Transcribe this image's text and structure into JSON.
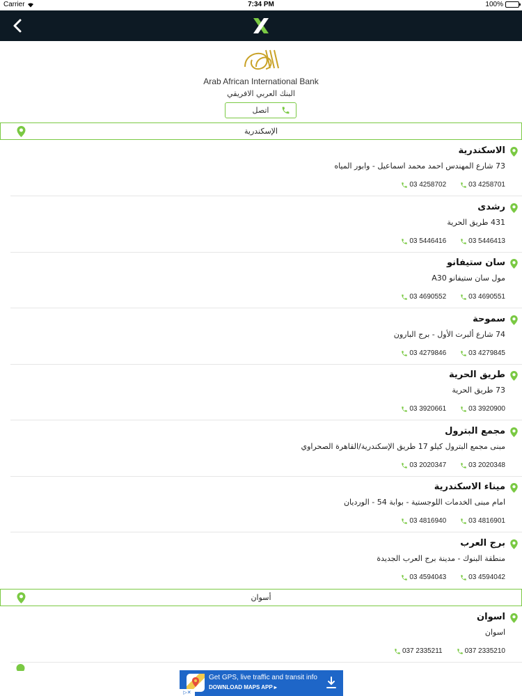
{
  "status_bar": {
    "carrier": "Carrier",
    "time": "7:34 PM",
    "battery": "100%"
  },
  "bank": {
    "name_en": "Arab African International Bank",
    "name_ar": "البنك العربي الافريقي",
    "call_label": "اتصل"
  },
  "colors": {
    "accent": "#7ac943",
    "nav_bg": "#0d1a24",
    "ad_bg": "#1e66c8"
  },
  "sections": [
    {
      "title": "الإسكندرية",
      "branches": [
        {
          "name": "الاسكندرية",
          "address": "73 شارع المهندس احمد محمد اسماعيل - وابور المياه",
          "phones": [
            "03 4258701",
            "03 4258702"
          ]
        },
        {
          "name": "رشدى",
          "address": "431 طريق الحرية",
          "phones": [
            "03 5446413",
            "03 5446416"
          ]
        },
        {
          "name": "سان ستيفانو",
          "address": "مول سان ستيفانو A30",
          "phones": [
            "03 4690551",
            "03 4690552"
          ]
        },
        {
          "name": "سموحة",
          "address": "74 شارع ألبرت الأول - برج البارون",
          "phones": [
            "03 4279845",
            "03 4279846"
          ]
        },
        {
          "name": "طريق الحرية",
          "address": "73 طريق الحرية",
          "phones": [
            "03 3920900",
            "03 3920661"
          ]
        },
        {
          "name": "مجمع البترول",
          "address": "مبنى مجمع البترول كيلو 17 طريق الإسكندرية/القاهرة الصحراوي",
          "phones": [
            "03 2020348",
            "03 2020347"
          ]
        },
        {
          "name": "ميناء الاسكندرية",
          "address": "امام مبنى الخدمات اللوجستية - بوابة 54 - الورديان",
          "phones": [
            "03 4816901",
            "03 4816940"
          ]
        },
        {
          "name": "برج العرب",
          "address": "منطقة البنوك - مدينة برج العرب الجديدة",
          "phones": [
            "03 4594042",
            "03 4594043"
          ]
        }
      ]
    },
    {
      "title": "أسوان",
      "branches": [
        {
          "name": "اسوان",
          "address": "اسوان",
          "phones": [
            "037 2335210",
            "037 2335211"
          ]
        }
      ]
    }
  ],
  "ad": {
    "title": "Get GPS, live traffic and transit info",
    "cta": "DOWNLOAD MAPS APP ▸"
  },
  "icons": {
    "back": "chevron-left-icon",
    "pin": "map-pin-icon",
    "phone": "phone-icon",
    "download": "download-icon"
  }
}
